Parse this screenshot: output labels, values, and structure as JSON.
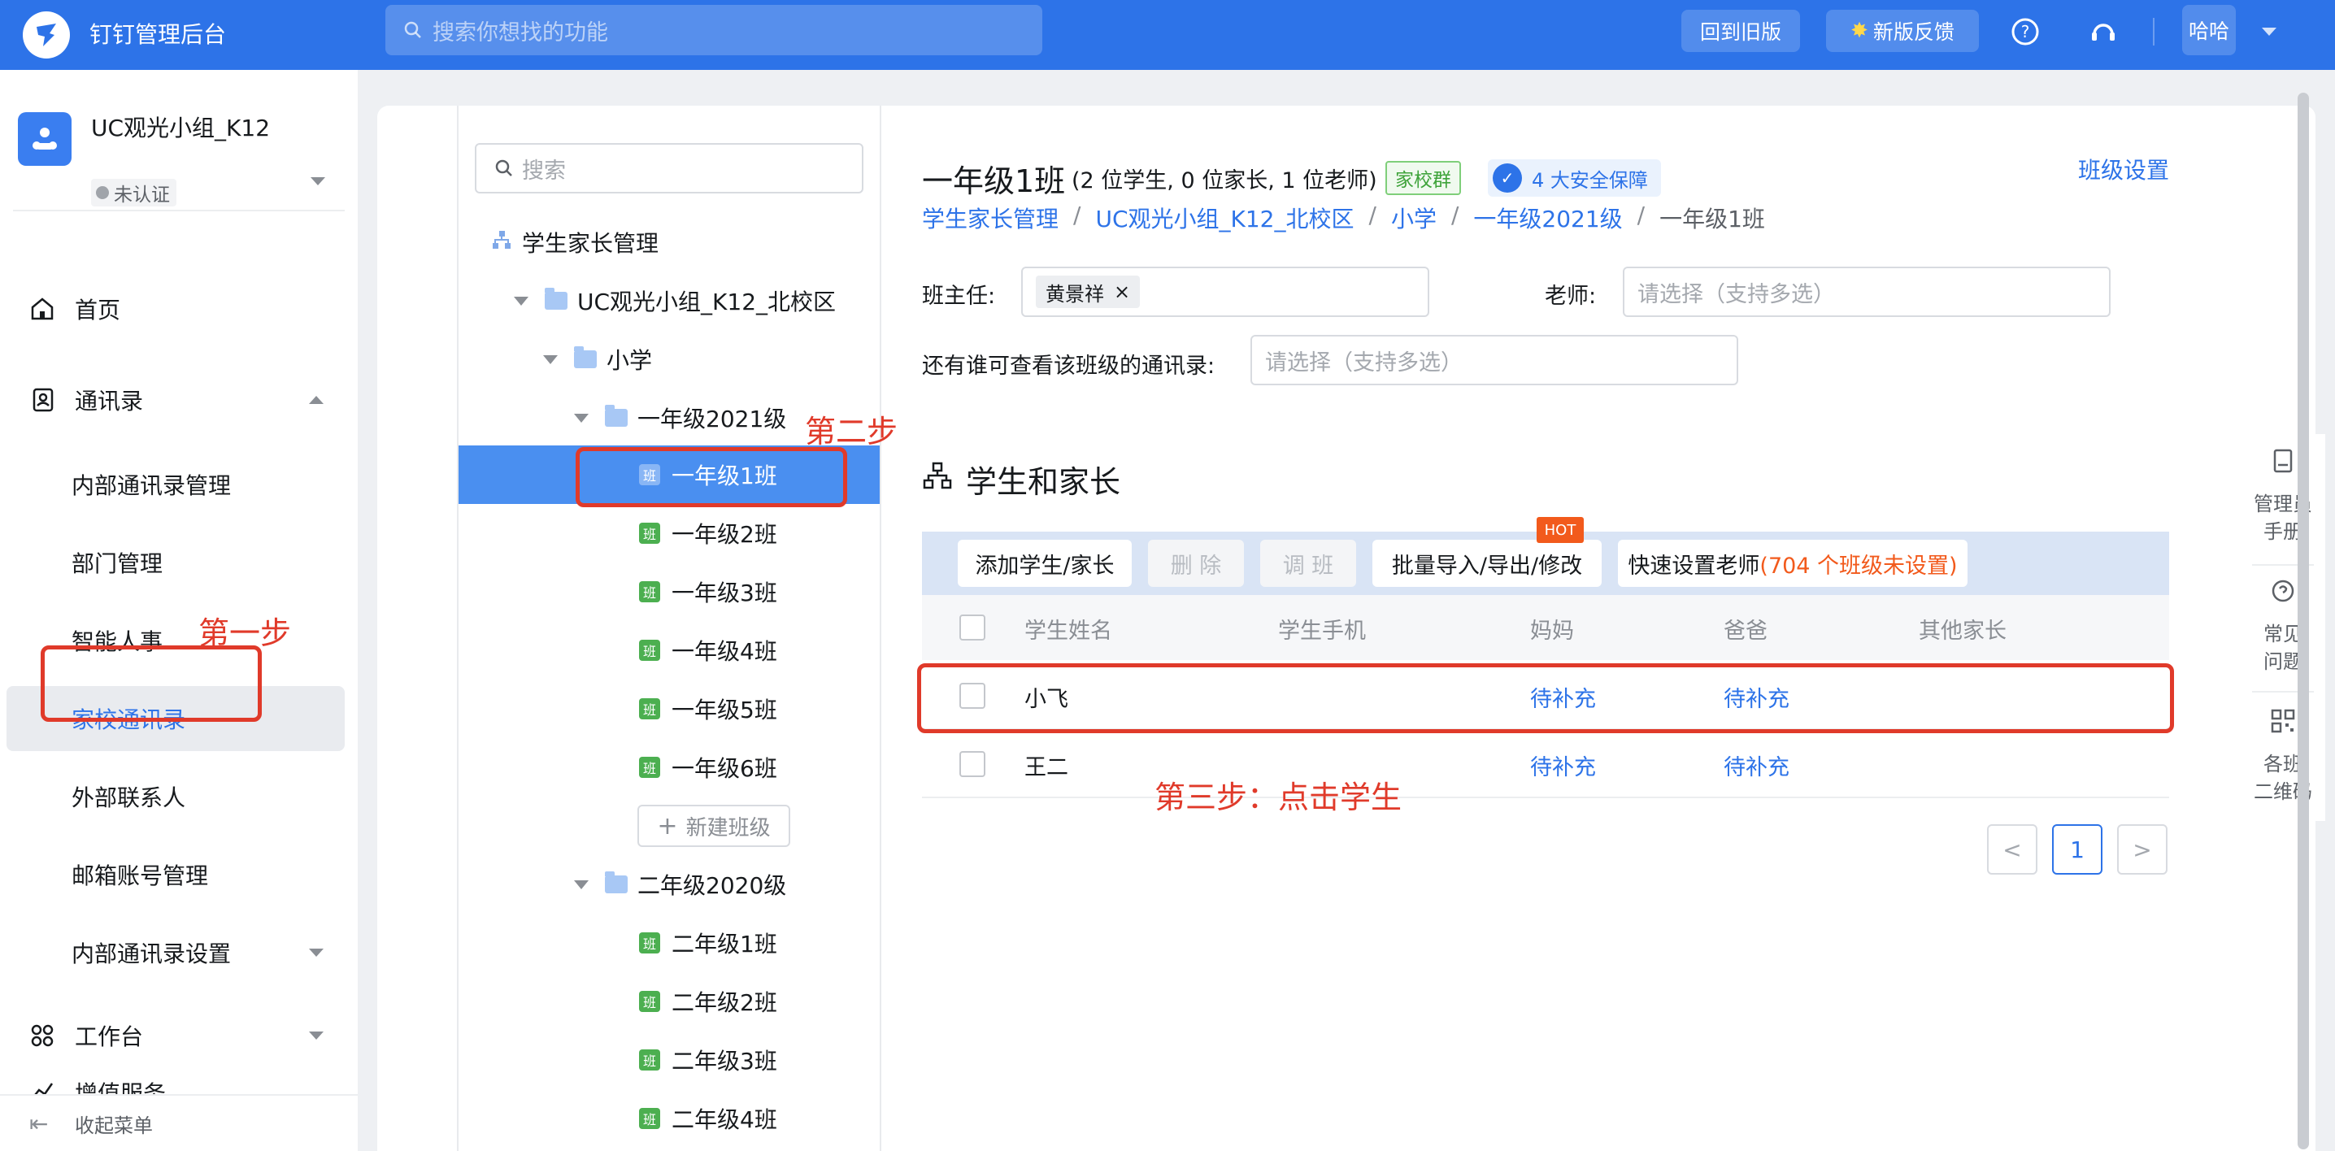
{
  "app": {
    "title": "钉钉管理后台",
    "search_placeholder": "搜索你想找的功能"
  },
  "topbar": {
    "old_version": "回到旧版",
    "feedback": "新版反馈",
    "user": "哈哈"
  },
  "org": {
    "name": "UC观光小组_K12",
    "status": "未认证"
  },
  "sidebar": {
    "home": "首页",
    "contacts": "通讯录",
    "items": [
      "内部通讯录管理",
      "部门管理",
      "智能人事",
      "家校通讯录",
      "外部联系人",
      "邮箱账号管理",
      "内部通讯录设置"
    ],
    "workbench": "工作台",
    "value_added": "增值服务",
    "collapse": "收起菜单"
  },
  "tree": {
    "search_placeholder": "搜索",
    "root": "学生家长管理",
    "campus": "UC观光小组_K12_北校区",
    "school": "小学",
    "grade1": "一年级2021级",
    "grade1_classes": [
      "一年级1班",
      "一年级2班",
      "一年级3班",
      "一年级4班",
      "一年级5班",
      "一年级6班"
    ],
    "new_class": "新建班级",
    "grade2": "二年级2020级",
    "grade2_classes": [
      "二年级1班",
      "二年级2班",
      "二年级3班",
      "二年级4班"
    ],
    "class_tag": "班"
  },
  "main": {
    "title": "一年级1班",
    "counts": "(2 位学生, 0 位家长, 1 位老师)",
    "tag": "家校群",
    "safety": "4 大安全保障",
    "class_settings": "班级设置",
    "breadcrumb": [
      "学生家长管理",
      "UC观光小组_K12_北校区",
      "小学",
      "一年级2021级",
      "一年级1班"
    ],
    "head_teacher_label": "班主任:",
    "head_teacher": "黄景祥",
    "teacher_label": "老师:",
    "teacher_placeholder": "请选择（支持多选）",
    "viewers_label": "还有谁可查看该班级的通讯录:",
    "viewers_placeholder": "请选择（支持多选）",
    "section_title": "学生和家长",
    "toolbar": {
      "add": "添加学生/家长",
      "delete": "删 除",
      "transfer": "调 班",
      "batch": "批量导入/导出/修改",
      "hot": "HOT",
      "quick_set": "快速设置老师",
      "quick_set_note": "(704 个班级未设置)"
    },
    "columns": [
      "学生姓名",
      "学生手机",
      "妈妈",
      "爸爸",
      "其他家长"
    ],
    "rows": [
      {
        "name": "小飞",
        "phone": "",
        "mom": "待补充",
        "dad": "待补充",
        "other": ""
      },
      {
        "name": "王二",
        "phone": "",
        "mom": "待补充",
        "dad": "待补充",
        "other": ""
      }
    ],
    "page": "1",
    "prev": "<",
    "next": ">"
  },
  "rail": {
    "manual": [
      "管理员",
      "手册"
    ],
    "faq": [
      "常见",
      "问题"
    ],
    "qrcode": [
      "各班",
      "二维码"
    ]
  },
  "annotations": {
    "step1": "第一步",
    "step2": "第二步",
    "step3": "第三步：点击学生"
  }
}
